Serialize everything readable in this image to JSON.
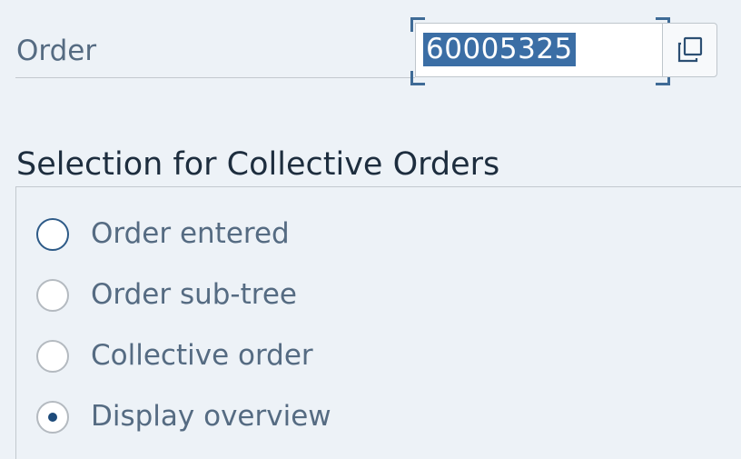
{
  "order_field": {
    "label": "Order",
    "value": "60005325",
    "value_selected": true,
    "value_help_icon": "copy-icon"
  },
  "collective_selection": {
    "title": "Selection for Collective Orders",
    "options": [
      {
        "label": "Order entered",
        "selected": false,
        "focused": true
      },
      {
        "label": "Order sub-tree",
        "selected": false,
        "focused": false
      },
      {
        "label": "Collective order",
        "selected": false,
        "focused": false
      },
      {
        "label": "Display overview",
        "selected": true,
        "focused": false
      }
    ]
  },
  "colors": {
    "background": "#edf2f7",
    "selection_highlight": "#3b6ea5",
    "focus_border": "#2d5a87",
    "label_text": "#556b82"
  }
}
